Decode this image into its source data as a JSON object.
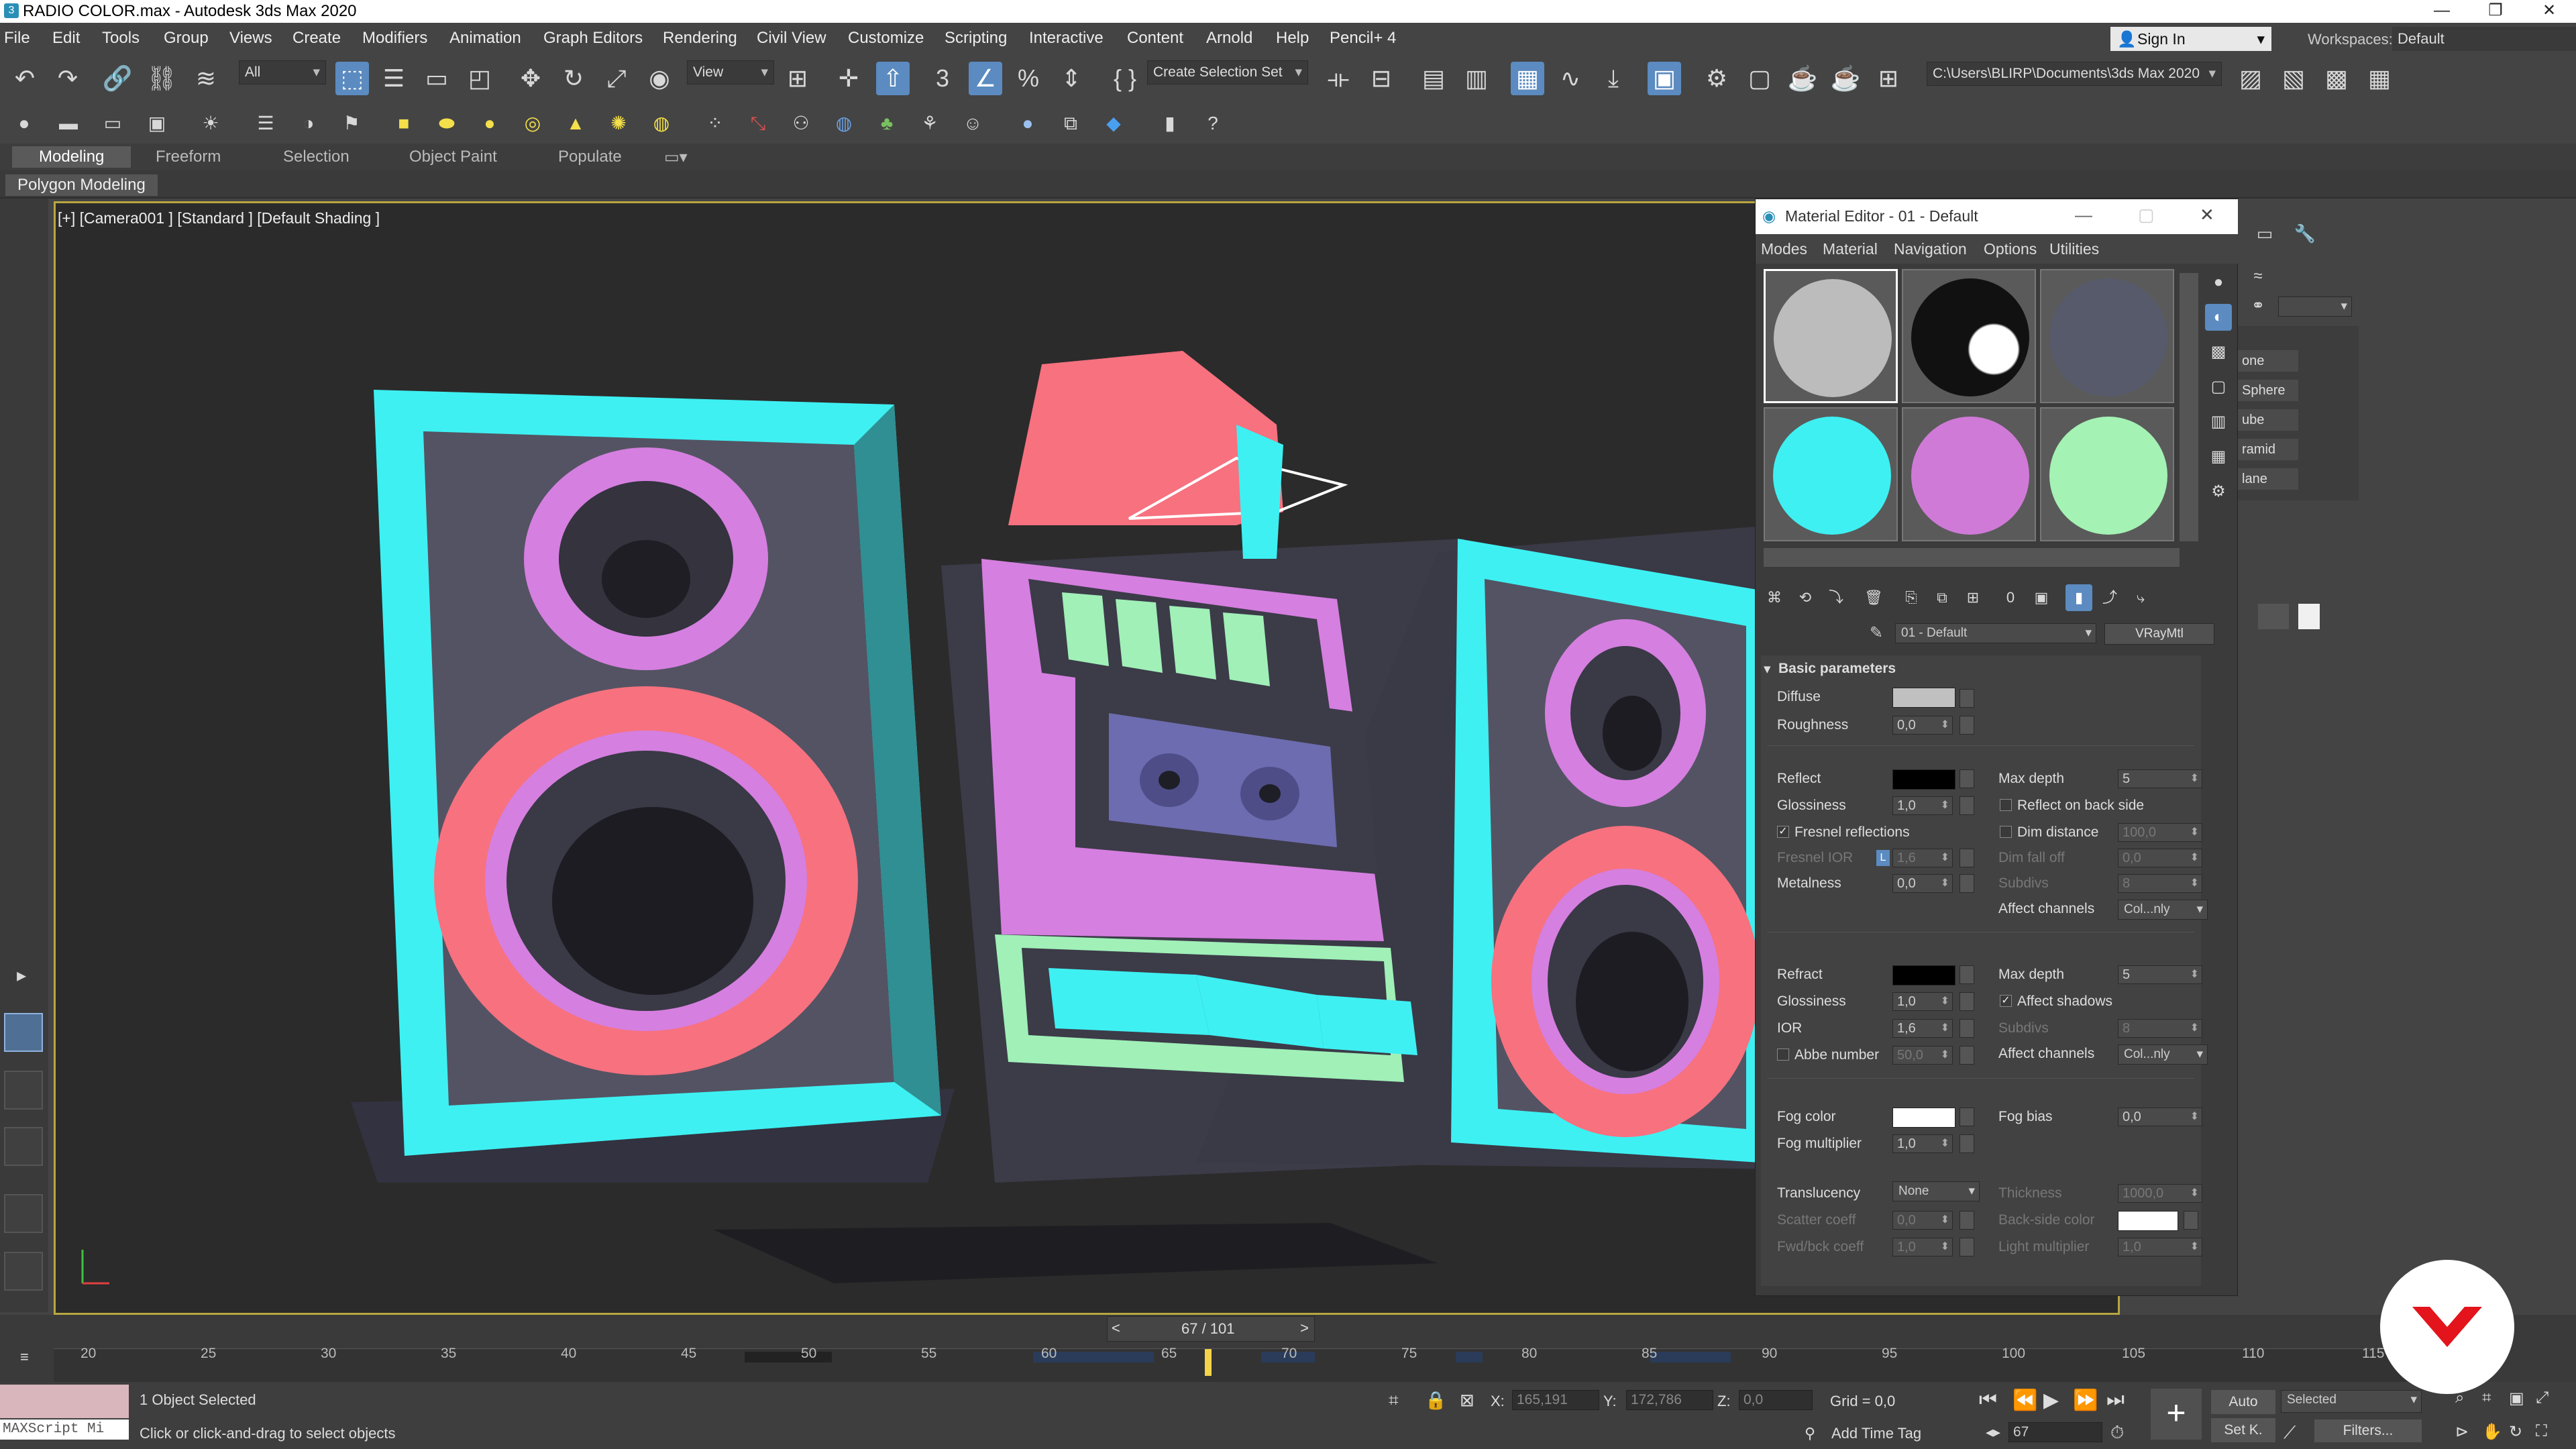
{
  "window": {
    "title": "RADIO COLOR.max - Autodesk 3ds Max 2020",
    "app_icon": "3ds-max-icon"
  },
  "menubar": {
    "items": [
      "File",
      "Edit",
      "Tools",
      "Group",
      "Views",
      "Create",
      "Modifiers",
      "Animation",
      "Graph Editors",
      "Rendering",
      "Civil View",
      "Customize",
      "Scripting",
      "Interactive",
      "Content",
      "Arnold",
      "Help",
      "Pencil+ 4"
    ],
    "signin": "Sign In",
    "workspaces_label": "Workspaces:",
    "workspace_value": "Default"
  },
  "toolbar": {
    "selection_filter": "All",
    "ref_coord": "View",
    "selection_set": "Create Selection Set",
    "project_path": "C:\\Users\\BLIRP\\Documents\\3ds Max 2020"
  },
  "ribbon": {
    "tabs": [
      "Modeling",
      "Freeform",
      "Selection",
      "Object Paint",
      "Populate"
    ],
    "active_tab": "Modeling",
    "panel": "Polygon Modeling"
  },
  "viewport": {
    "label": "[+] [Camera001 ] [Standard ] [Default Shading ]",
    "frame_border_color": "#b8a640",
    "colors": {
      "cyan": "#3ef0f2",
      "pink": "#f7717f",
      "magenta": "#d57fe0",
      "mint": "#a0f0b8",
      "panel": "#545363",
      "dark": "#1c1c22"
    }
  },
  "material_editor": {
    "title": "Material Editor - 01 - Default",
    "menu": [
      "Modes",
      "Material",
      "Navigation",
      "Options",
      "Utilities"
    ],
    "slot_colors": [
      "#bcbcbc",
      "#111111",
      "#575a6b",
      "#3ef0f2",
      "#d07ad8",
      "#a4f2b4"
    ],
    "material_name": "01 - Default",
    "material_type": "VRayMtl",
    "section": "Basic parameters",
    "diffuse_label": "Diffuse",
    "diffuse_color": "#c0c0c0",
    "roughness_label": "Roughness",
    "roughness": "0,0",
    "reflect_label": "Reflect",
    "reflect_color": "#000000",
    "glossiness_label": "Glossiness",
    "glossiness": "1,0",
    "fresnel_label": "Fresnel reflections",
    "fresnel_ior_label": "Fresnel IOR",
    "fresnel_ior_lock": "L",
    "fresnel_ior": "1,6",
    "metalness_label": "Metalness",
    "metalness": "0,0",
    "max_depth_label": "Max depth",
    "max_depth": "5",
    "reflect_back_label": "Reflect on back side",
    "dim_distance_label": "Dim distance",
    "dim_distance": "100,0",
    "dim_falloff_label": "Dim fall off",
    "dim_falloff": "0,0",
    "subdivs_label": "Subdivs",
    "subdivs": "8",
    "affect_channels_label": "Affect channels",
    "affect_channels": "Col...nly",
    "refract_label": "Refract",
    "refract_color": "#000000",
    "refract_glossiness": "1,0",
    "ior_label": "IOR",
    "ior": "1,6",
    "abbe_label": "Abbe number",
    "abbe": "50,0",
    "refract_max_depth": "5",
    "affect_shadows_label": "Affect shadows",
    "refract_subdivs": "8",
    "refract_affect_channels": "Col...nly",
    "fog_color_label": "Fog color",
    "fog_color": "#ffffff",
    "fog_mult_label": "Fog multiplier",
    "fog_mult": "1,0",
    "fog_bias_label": "Fog bias",
    "fog_bias": "0,0",
    "translucency_label": "Translucency",
    "translucency": "None",
    "thickness_label": "Thickness",
    "thickness": "1000,0",
    "scatter_label": "Scatter coeff",
    "scatter": "0,0",
    "backside_label": "Back-side color",
    "backside_color": "#ffffff",
    "fwdbck_label": "Fwd/bck coeff",
    "fwdbck": "1,0",
    "light_mult_label": "Light multiplier",
    "light_mult": "1,0"
  },
  "command_panel": {
    "items": [
      "one",
      "Sphere",
      "ube",
      "ramid",
      "lane"
    ]
  },
  "timeline": {
    "frame": "67 / 101",
    "ticks": [
      "20",
      "25",
      "30",
      "35",
      "40",
      "45",
      "50",
      "55",
      "60",
      "65",
      "70",
      "75",
      "80",
      "85",
      "90",
      "95",
      "100",
      "105",
      "110",
      "115"
    ]
  },
  "status": {
    "maxscript": "MAXScript Mi",
    "selected": "1 Object Selected",
    "prompt": "Click or click-and-drag to select objects",
    "x_label": "X:",
    "x": "165,191",
    "y_label": "Y:",
    "y": "172,786",
    "z_label": "Z:",
    "z": "0,0",
    "grid": "Grid = 0,0",
    "add_time_tag": "Add Time Tag",
    "auto": "Auto",
    "set_key": "Set K.",
    "selected_filter": "Selected",
    "filters": "Filters...",
    "current_frame": "67"
  }
}
